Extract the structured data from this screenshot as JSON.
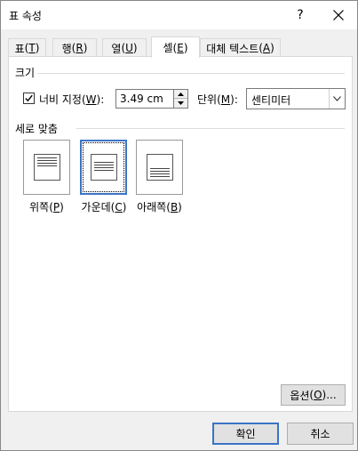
{
  "dialog": {
    "title": "표 속성",
    "help_label": "?"
  },
  "tabs": [
    {
      "label": "표",
      "accel": "T"
    },
    {
      "label": "행",
      "accel": "R"
    },
    {
      "label": "열",
      "accel": "U"
    },
    {
      "label": "셀",
      "accel": "E",
      "active": true
    },
    {
      "label": "대체 텍스트",
      "accel": "A"
    }
  ],
  "size_group": {
    "label": "크기",
    "preferred_width": {
      "label": "너비 지정",
      "accel": "W",
      "checked": true
    },
    "width_value": "3.49 cm",
    "unit": {
      "label": "단위",
      "accel": "M",
      "value": "센티미터"
    }
  },
  "vertical_alignment": {
    "label": "세로 맞춤",
    "options": [
      {
        "label": "위쪽",
        "accel": "P"
      },
      {
        "label": "가운데",
        "accel": "C",
        "selected": true
      },
      {
        "label": "아래쪽",
        "accel": "B"
      }
    ]
  },
  "buttons": {
    "options": {
      "label": "옵션",
      "accel": "O",
      "suffix": "..."
    },
    "ok": "확인",
    "cancel": "취소"
  }
}
